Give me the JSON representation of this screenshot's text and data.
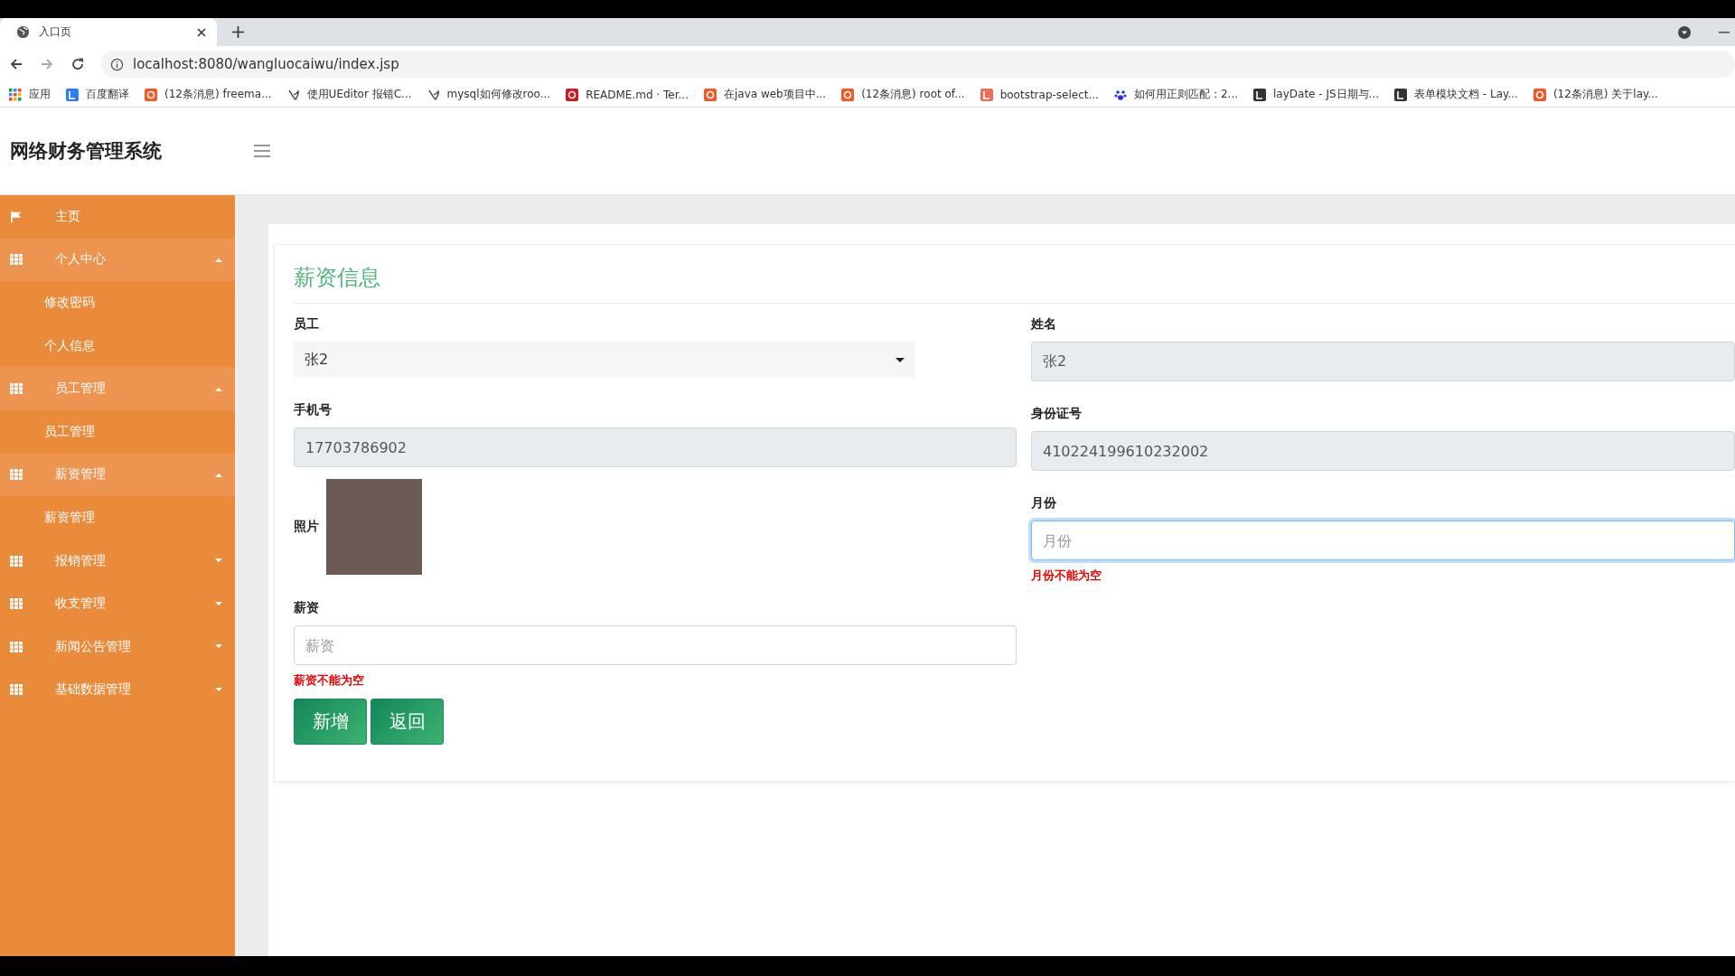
{
  "browser": {
    "tab_title": "入口页",
    "url": "localhost:8080/wangluocaiwu/index.jsp",
    "bookmarks": [
      {
        "kind": "apps",
        "label": "应用"
      },
      {
        "kind": "translate",
        "label": "百度翻译"
      },
      {
        "kind": "csdn",
        "label": "(12条消息) freema..."
      },
      {
        "kind": "bird",
        "label": "使用UEditor 报错C..."
      },
      {
        "kind": "bird",
        "label": "mysql如何修改roo..."
      },
      {
        "kind": "gitee",
        "label": "README.md · Ter..."
      },
      {
        "kind": "csdn",
        "label": "在java web项目中..."
      },
      {
        "kind": "csdn",
        "label": "(12条消息) root of..."
      },
      {
        "kind": "jianshu",
        "label": "bootstrap-select..."
      },
      {
        "kind": "baidu",
        "label": "如何用正则匹配：2..."
      },
      {
        "kind": "layui",
        "label": "layDate - JS日期与..."
      },
      {
        "kind": "layui",
        "label": "表单模块文档 - Lay..."
      },
      {
        "kind": "csdn",
        "label": "(12条消息) 关于lay..."
      }
    ]
  },
  "app": {
    "title": "网络财务管理系统"
  },
  "sidebar": {
    "items": [
      {
        "kind": "link",
        "label": "主页"
      },
      {
        "kind": "group",
        "label": "个人中心",
        "expanded": true,
        "children": [
          {
            "label": "修改密码"
          },
          {
            "label": "个人信息"
          }
        ]
      },
      {
        "kind": "group",
        "label": "员工管理",
        "expanded": true,
        "children": [
          {
            "label": "员工管理"
          }
        ]
      },
      {
        "kind": "group",
        "label": "薪资管理",
        "expanded": true,
        "children": [
          {
            "label": "薪资管理"
          }
        ]
      },
      {
        "kind": "group",
        "label": "报销管理",
        "expanded": false
      },
      {
        "kind": "group",
        "label": "收支管理",
        "expanded": false
      },
      {
        "kind": "group",
        "label": "新闻公告管理",
        "expanded": false
      },
      {
        "kind": "group",
        "label": "基础数据管理",
        "expanded": false
      }
    ]
  },
  "form": {
    "title": "薪资信息",
    "left": [
      {
        "kind": "select",
        "label": "员工",
        "value": "张2"
      },
      {
        "kind": "readonly",
        "label": "手机号",
        "value": "17703786902"
      },
      {
        "kind": "photo",
        "label": "照片"
      },
      {
        "kind": "input",
        "label": "薪资",
        "placeholder": "薪资",
        "error": "薪资不能为空",
        "focused": false
      }
    ],
    "right": [
      {
        "kind": "readonly",
        "label": "姓名",
        "value": "张2"
      },
      {
        "kind": "readonly",
        "label": "身份证号",
        "value": "410224199610232002"
      },
      {
        "kind": "input",
        "label": "月份",
        "placeholder": "月份",
        "error": "月份不能为空",
        "focused": true
      }
    ],
    "buttons": [
      "新增",
      "返回"
    ]
  }
}
